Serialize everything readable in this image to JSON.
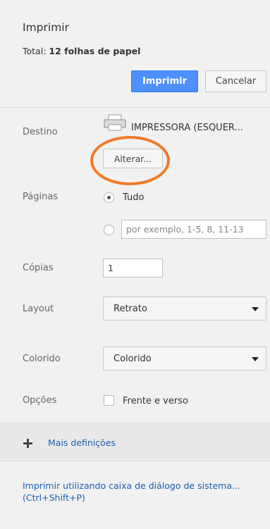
{
  "header": {
    "title": "Imprimir",
    "total_label": "Total:",
    "total_value": "12 folhas de papel",
    "print_label": "Imprimir",
    "cancel_label": "Cancelar"
  },
  "destination": {
    "label": "Destino",
    "printer_name": "IMPRESSORA (ESQUER...",
    "change_label": "Alterar...",
    "icon": "printer-icon",
    "highlight_color": "#ef7b2a"
  },
  "pages": {
    "label": "Páginas",
    "all_label": "Tudo",
    "custom_placeholder": "por exemplo, 1-5, 8, 11-13",
    "selected": "all"
  },
  "copies": {
    "label": "Cópias",
    "value": "1"
  },
  "layout": {
    "label": "Layout",
    "value": "Retrato"
  },
  "color": {
    "label": "Colorido",
    "value": "Colorido"
  },
  "options": {
    "label": "Opções",
    "duplex_label": "Frente e verso",
    "duplex_checked": false
  },
  "more": {
    "label": "Mais definições"
  },
  "system_dialog": {
    "line1": "Imprimir utilizando caixa de diálogo de sistema...",
    "line2": "(Ctrl+Shift+P)"
  },
  "colors": {
    "primary_button": "#4d90fe",
    "link": "#1a5fb4"
  }
}
